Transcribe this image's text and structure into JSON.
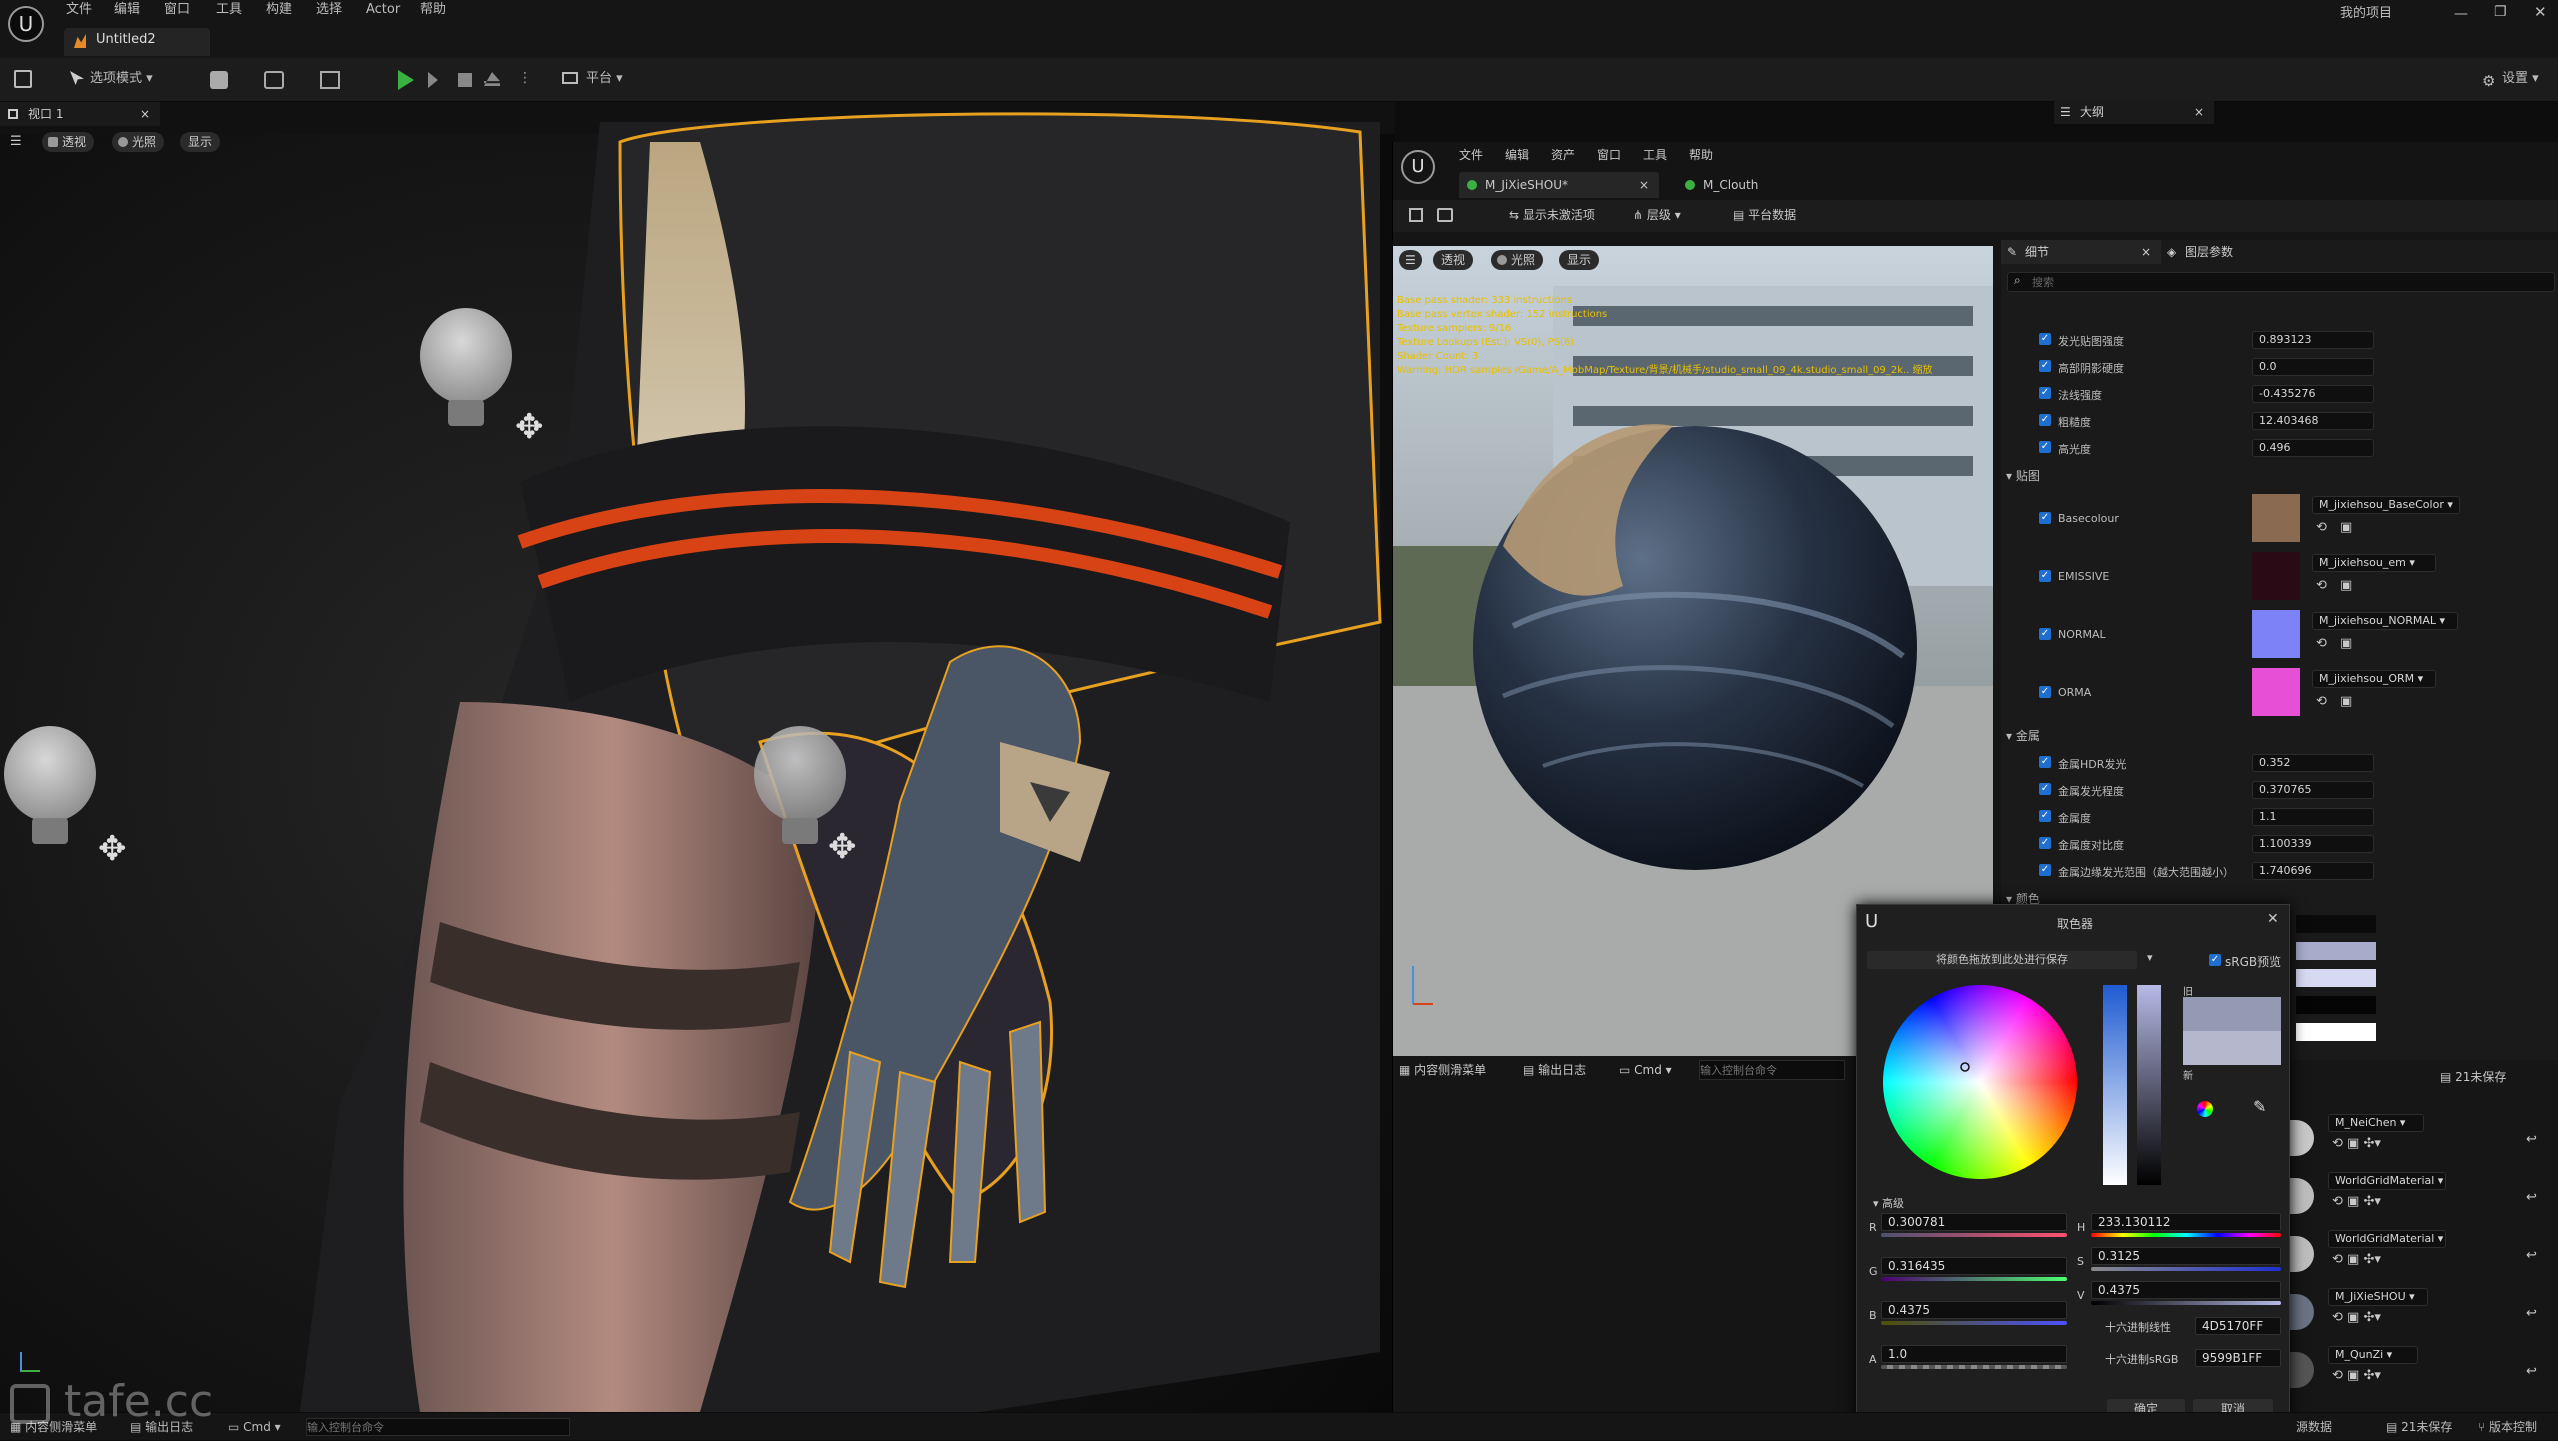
{
  "menubar": {
    "items": [
      "文件",
      "编辑",
      "窗口",
      "工具",
      "构建",
      "选择",
      "Actor",
      "帮助"
    ],
    "project": "我的项目",
    "doc_tab": "Untitled2"
  },
  "toolbar": {
    "mode": "选项模式",
    "platform": "平台",
    "settings": "设置"
  },
  "viewport": {
    "tab": "视口 1",
    "perspective": "透视",
    "lit": "光照",
    "show": "显示"
  },
  "outliner": {
    "tab": "大纲"
  },
  "material_editor": {
    "menu": [
      "文件",
      "编辑",
      "资产",
      "窗口",
      "工具",
      "帮助"
    ],
    "tabs": [
      "M_JiXieSHOU*",
      "M_Clouth"
    ],
    "toolbar": {
      "show_inactive": "显示未激活项",
      "hierarchy": "层级",
      "platform_stats": "平台数据"
    },
    "preview": {
      "perspective": "透视",
      "lit": "光照",
      "show": "显示",
      "stats": [
        "Base pass shader: 333 instructions",
        "Base pass vertex shader: 152 instructions",
        "Texture samplers: 9/16",
        "Texture Lookups (Est.): VS(0), PS(6)",
        "Shader Count: 3",
        "Warning: HDR samples /Game/A_MobMap/Texture/背景/机械手/studio_small_09_4k.studio_small_09_2k.. 缩放"
      ]
    },
    "details": {
      "tab": "细节",
      "layer_tab": "图层参数",
      "search_placeholder": "搜索",
      "scalar_rows": [
        {
          "label": "发光贴图强度",
          "value": "0.893123"
        },
        {
          "label": "高部阴影硬度",
          "value": "0.0"
        },
        {
          "label": "法线强度",
          "value": "-0.435276"
        },
        {
          "label": "粗糙度",
          "value": "12.403468"
        },
        {
          "label": "高光度",
          "value": "0.496"
        }
      ],
      "texture_section": "贴图",
      "textures": [
        {
          "label": "Basecolour",
          "asset": "M_jixiehsou_BaseColor",
          "color": "#8b6a52"
        },
        {
          "label": "EMISSIVE",
          "asset": "M_jixiehsou_em",
          "color": "#2a0a14"
        },
        {
          "label": "NORMAL",
          "asset": "M_jixiehsou_NORMAL",
          "color": "#7d82f5"
        },
        {
          "label": "ORMA",
          "asset": "M_jixiehsou_ORM",
          "color": "#e64fd6"
        }
      ],
      "metal_section": "金属",
      "metal_rows": [
        {
          "label": "金属HDR发光",
          "value": "0.352"
        },
        {
          "label": "金属发光程度",
          "value": "0.370765"
        },
        {
          "label": "金属度",
          "value": "1.1"
        },
        {
          "label": "金属度对比度",
          "value": "1.100339"
        },
        {
          "label": "金属边缘发光范围（越大范围越小）",
          "value": "1.740696"
        }
      ],
      "color_section": "颜色"
    },
    "console": {
      "drawer": "内容侧滑菜单",
      "log": "输出日志",
      "cmd": "Cmd",
      "placeholder": "输入控制台命令"
    }
  },
  "color_picker": {
    "title": "取色器",
    "save_hint": "将颜色拖放到此处进行保存",
    "srgb": "sRGB预览",
    "old": "旧",
    "new": "新",
    "advanced": "高级",
    "r": "0.300781",
    "g": "0.316435",
    "b": "0.4375",
    "a": "1.0",
    "h": "233.130112",
    "s": "0.3125",
    "v": "0.4375",
    "hex_linear_label": "十六进制线性",
    "hex_linear": "4D5170FF",
    "hex_srgb_label": "十六进制sRGB",
    "hex_srgb": "9599B1FF",
    "ok": "确定",
    "cancel": "取消",
    "old_color": "#9599b1",
    "new_color": "#b5b8cc"
  },
  "right_list": {
    "unsaved": "21未保存",
    "items": [
      "M_NeiChen",
      "WorldGridMaterial",
      "WorldGridMaterial",
      "M_JiXieSHOU",
      "M_QunZi"
    ]
  },
  "statusbar": {
    "drawer": "内容侧滑菜单",
    "log": "输出日志",
    "cmd": "Cmd",
    "placeholder": "输入控制台命令",
    "source_data": "源数据",
    "unsaved": "21未保存",
    "version": "版本控制"
  },
  "watermark": "tafe.cc"
}
